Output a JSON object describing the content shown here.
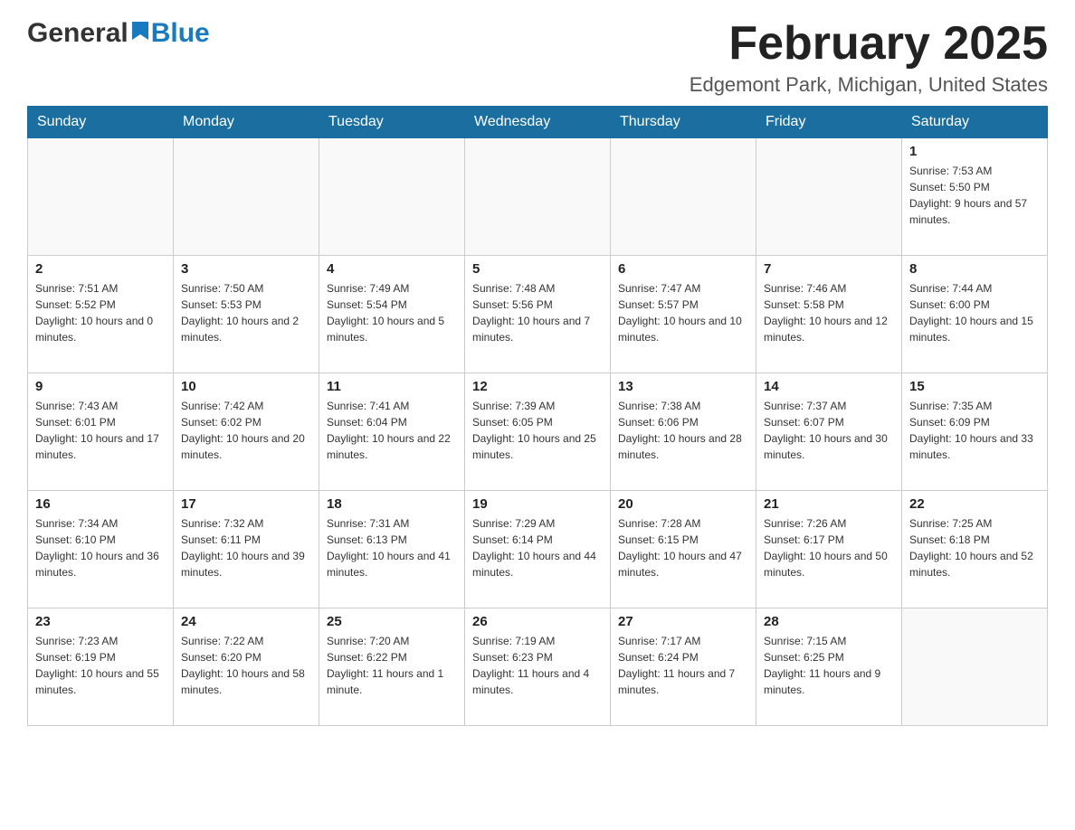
{
  "header": {
    "logo_general": "General",
    "logo_blue": "Blue",
    "month_title": "February 2025",
    "location": "Edgemont Park, Michigan, United States"
  },
  "weekdays": [
    "Sunday",
    "Monday",
    "Tuesday",
    "Wednesday",
    "Thursday",
    "Friday",
    "Saturday"
  ],
  "weeks": [
    [
      {
        "day": "",
        "sunrise": "",
        "sunset": "",
        "daylight": ""
      },
      {
        "day": "",
        "sunrise": "",
        "sunset": "",
        "daylight": ""
      },
      {
        "day": "",
        "sunrise": "",
        "sunset": "",
        "daylight": ""
      },
      {
        "day": "",
        "sunrise": "",
        "sunset": "",
        "daylight": ""
      },
      {
        "day": "",
        "sunrise": "",
        "sunset": "",
        "daylight": ""
      },
      {
        "day": "",
        "sunrise": "",
        "sunset": "",
        "daylight": ""
      },
      {
        "day": "1",
        "sunrise": "Sunrise: 7:53 AM",
        "sunset": "Sunset: 5:50 PM",
        "daylight": "Daylight: 9 hours and 57 minutes."
      }
    ],
    [
      {
        "day": "2",
        "sunrise": "Sunrise: 7:51 AM",
        "sunset": "Sunset: 5:52 PM",
        "daylight": "Daylight: 10 hours and 0 minutes."
      },
      {
        "day": "3",
        "sunrise": "Sunrise: 7:50 AM",
        "sunset": "Sunset: 5:53 PM",
        "daylight": "Daylight: 10 hours and 2 minutes."
      },
      {
        "day": "4",
        "sunrise": "Sunrise: 7:49 AM",
        "sunset": "Sunset: 5:54 PM",
        "daylight": "Daylight: 10 hours and 5 minutes."
      },
      {
        "day": "5",
        "sunrise": "Sunrise: 7:48 AM",
        "sunset": "Sunset: 5:56 PM",
        "daylight": "Daylight: 10 hours and 7 minutes."
      },
      {
        "day": "6",
        "sunrise": "Sunrise: 7:47 AM",
        "sunset": "Sunset: 5:57 PM",
        "daylight": "Daylight: 10 hours and 10 minutes."
      },
      {
        "day": "7",
        "sunrise": "Sunrise: 7:46 AM",
        "sunset": "Sunset: 5:58 PM",
        "daylight": "Daylight: 10 hours and 12 minutes."
      },
      {
        "day": "8",
        "sunrise": "Sunrise: 7:44 AM",
        "sunset": "Sunset: 6:00 PM",
        "daylight": "Daylight: 10 hours and 15 minutes."
      }
    ],
    [
      {
        "day": "9",
        "sunrise": "Sunrise: 7:43 AM",
        "sunset": "Sunset: 6:01 PM",
        "daylight": "Daylight: 10 hours and 17 minutes."
      },
      {
        "day": "10",
        "sunrise": "Sunrise: 7:42 AM",
        "sunset": "Sunset: 6:02 PM",
        "daylight": "Daylight: 10 hours and 20 minutes."
      },
      {
        "day": "11",
        "sunrise": "Sunrise: 7:41 AM",
        "sunset": "Sunset: 6:04 PM",
        "daylight": "Daylight: 10 hours and 22 minutes."
      },
      {
        "day": "12",
        "sunrise": "Sunrise: 7:39 AM",
        "sunset": "Sunset: 6:05 PM",
        "daylight": "Daylight: 10 hours and 25 minutes."
      },
      {
        "day": "13",
        "sunrise": "Sunrise: 7:38 AM",
        "sunset": "Sunset: 6:06 PM",
        "daylight": "Daylight: 10 hours and 28 minutes."
      },
      {
        "day": "14",
        "sunrise": "Sunrise: 7:37 AM",
        "sunset": "Sunset: 6:07 PM",
        "daylight": "Daylight: 10 hours and 30 minutes."
      },
      {
        "day": "15",
        "sunrise": "Sunrise: 7:35 AM",
        "sunset": "Sunset: 6:09 PM",
        "daylight": "Daylight: 10 hours and 33 minutes."
      }
    ],
    [
      {
        "day": "16",
        "sunrise": "Sunrise: 7:34 AM",
        "sunset": "Sunset: 6:10 PM",
        "daylight": "Daylight: 10 hours and 36 minutes."
      },
      {
        "day": "17",
        "sunrise": "Sunrise: 7:32 AM",
        "sunset": "Sunset: 6:11 PM",
        "daylight": "Daylight: 10 hours and 39 minutes."
      },
      {
        "day": "18",
        "sunrise": "Sunrise: 7:31 AM",
        "sunset": "Sunset: 6:13 PM",
        "daylight": "Daylight: 10 hours and 41 minutes."
      },
      {
        "day": "19",
        "sunrise": "Sunrise: 7:29 AM",
        "sunset": "Sunset: 6:14 PM",
        "daylight": "Daylight: 10 hours and 44 minutes."
      },
      {
        "day": "20",
        "sunrise": "Sunrise: 7:28 AM",
        "sunset": "Sunset: 6:15 PM",
        "daylight": "Daylight: 10 hours and 47 minutes."
      },
      {
        "day": "21",
        "sunrise": "Sunrise: 7:26 AM",
        "sunset": "Sunset: 6:17 PM",
        "daylight": "Daylight: 10 hours and 50 minutes."
      },
      {
        "day": "22",
        "sunrise": "Sunrise: 7:25 AM",
        "sunset": "Sunset: 6:18 PM",
        "daylight": "Daylight: 10 hours and 52 minutes."
      }
    ],
    [
      {
        "day": "23",
        "sunrise": "Sunrise: 7:23 AM",
        "sunset": "Sunset: 6:19 PM",
        "daylight": "Daylight: 10 hours and 55 minutes."
      },
      {
        "day": "24",
        "sunrise": "Sunrise: 7:22 AM",
        "sunset": "Sunset: 6:20 PM",
        "daylight": "Daylight: 10 hours and 58 minutes."
      },
      {
        "day": "25",
        "sunrise": "Sunrise: 7:20 AM",
        "sunset": "Sunset: 6:22 PM",
        "daylight": "Daylight: 11 hours and 1 minute."
      },
      {
        "day": "26",
        "sunrise": "Sunrise: 7:19 AM",
        "sunset": "Sunset: 6:23 PM",
        "daylight": "Daylight: 11 hours and 4 minutes."
      },
      {
        "day": "27",
        "sunrise": "Sunrise: 7:17 AM",
        "sunset": "Sunset: 6:24 PM",
        "daylight": "Daylight: 11 hours and 7 minutes."
      },
      {
        "day": "28",
        "sunrise": "Sunrise: 7:15 AM",
        "sunset": "Sunset: 6:25 PM",
        "daylight": "Daylight: 11 hours and 9 minutes."
      },
      {
        "day": "",
        "sunrise": "",
        "sunset": "",
        "daylight": ""
      }
    ]
  ]
}
